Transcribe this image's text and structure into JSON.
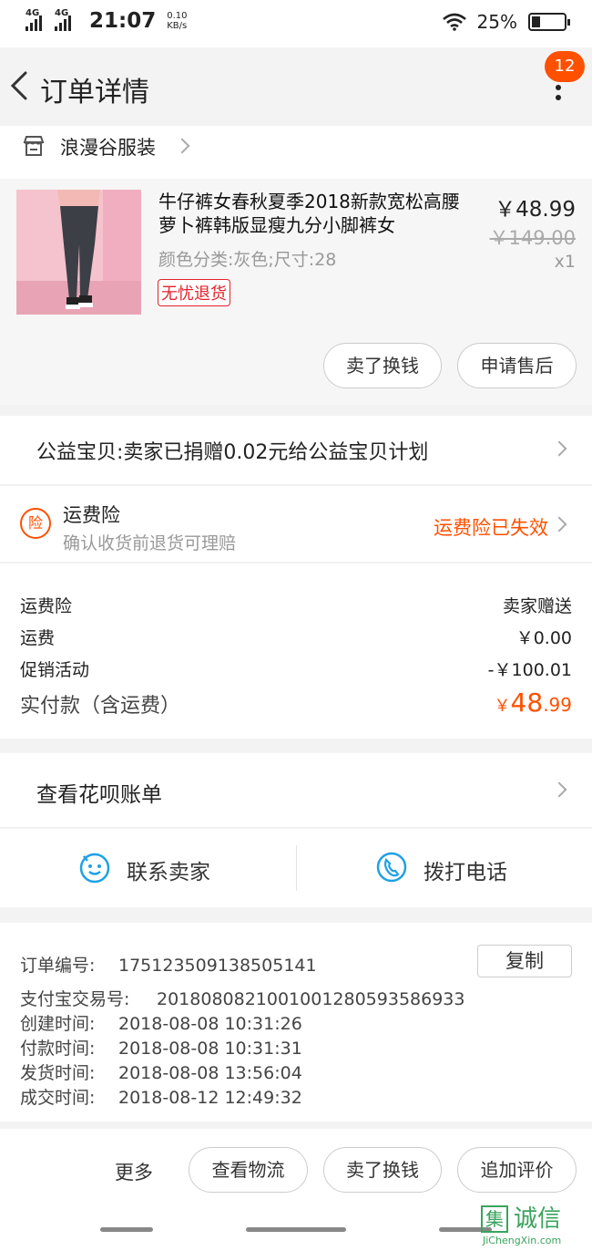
{
  "status_bar": {
    "net1": "4G",
    "net2": "4G",
    "time": "21:07",
    "speed_value": "0.10",
    "speed_unit": "KB/s",
    "battery": "25%",
    "battery_level": 0.25
  },
  "nav": {
    "title": "订单详情",
    "badge": "12"
  },
  "shop": {
    "name": "浪漫谷服装"
  },
  "product": {
    "title": "牛仔裤女春秋夏季2018新款宽松高腰萝卜裤韩版显瘦九分小脚裤女",
    "spec": "颜色分类:灰色;尺寸:28",
    "tag": "无忧退货",
    "price": "￥48.99",
    "original_price": "￥149.00",
    "qty": "x1",
    "btn_exchange": "卖了换钱",
    "btn_after_sale": "申请售后"
  },
  "charity": {
    "text": "公益宝贝:卖家已捐赠0.02元给公益宝贝计划"
  },
  "insurance": {
    "icon_text": "险",
    "title": "运费险",
    "subtitle": "确认收货前退货可理赔",
    "status": "运费险已失效"
  },
  "fees": {
    "rows": [
      {
        "label": "运费险",
        "value": "卖家赠送"
      },
      {
        "label": "运费",
        "value": "￥0.00"
      },
      {
        "label": "促销活动",
        "value": "-￥100.01"
      }
    ],
    "total_label": "实付款（含运费）",
    "total_symbol": "￥",
    "total_int": "48",
    "total_dec": ".99"
  },
  "huabei": {
    "text": "查看花呗账单"
  },
  "contact": {
    "seller": "联系卖家",
    "phone": "拨打电话"
  },
  "order_info": {
    "order_no_label": "订单编号:",
    "order_no": "175123509138505141",
    "copy_label": "复制",
    "alipay_label": "支付宝交易号:",
    "alipay_no": "2018080821001001280593586933",
    "created_label": "创建时间:",
    "created": "2018-08-08 10:31:26",
    "paid_label": "付款时间:",
    "paid": "2018-08-08 10:31:31",
    "shipped_label": "发货时间:",
    "shipped": "2018-08-08 13:56:04",
    "closed_label": "成交时间:",
    "closed": "2018-08-12 12:49:32"
  },
  "bottom": {
    "more": "更多",
    "logistics": "查看物流",
    "exchange": "卖了换钱",
    "review": "追加评价"
  },
  "watermark": {
    "box": "集",
    "cn": "诚信",
    "en": "JiChengXin.com"
  },
  "colors": {
    "accent": "#ff5000",
    "tag_red": "#e4222e",
    "icon_blue": "#1fa1e4"
  }
}
